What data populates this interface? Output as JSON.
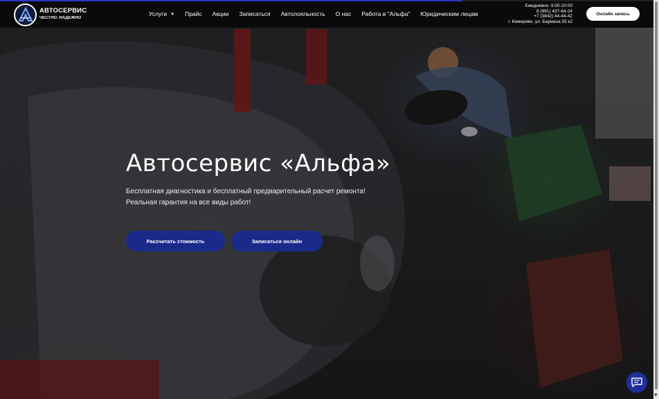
{
  "header": {
    "logo": {
      "title": "АВТОСЕРВИС",
      "subtitle": "ЧЕСТНО. НАДЕЖНО",
      "emblem_text": "альфа"
    },
    "nav": [
      {
        "label": "Услуги",
        "has_dropdown": true
      },
      {
        "label": "Прайс"
      },
      {
        "label": "Акции"
      },
      {
        "label": "Записаться"
      },
      {
        "label": "Автолояльность"
      },
      {
        "label": "О нас"
      },
      {
        "label": "Работа в \"Альфа\""
      },
      {
        "label": "Юридическим лицам"
      }
    ],
    "contacts": {
      "hours": "Ежедневно: 9:00-20:00",
      "phone1": "8 (991) 437-64-24",
      "phone2": "+7 (3842) 44-44-42",
      "address": "г. Кемерово, ул. Баумана 55 к2"
    },
    "online_button": "Онлайн запись"
  },
  "hero": {
    "title": "Автосервис «Альфа»",
    "line1": "Бесплатная диагностика и бесплатный предварительный расчет ремонта!",
    "line2": "Реальная гарантия на все виды работ!",
    "buttons": {
      "calculate": "Рассчитать стоимость",
      "book": "Записаться онлайн"
    }
  },
  "icons": {
    "caret": "caret-down-icon",
    "chat": "chat-bubble-icon"
  },
  "colors": {
    "accent": "#1a2a8a",
    "header_bg": "#0a0a0a",
    "progress": "#2a36c8"
  }
}
